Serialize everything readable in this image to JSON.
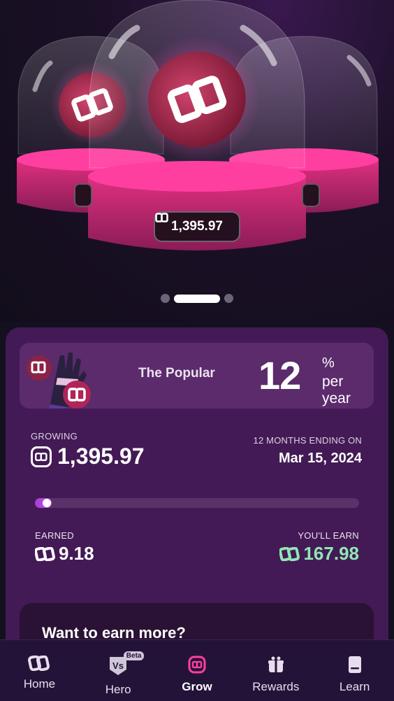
{
  "hero": {
    "amount": "1,395.97",
    "carousel_pages": 3,
    "carousel_active": 2
  },
  "plan": {
    "name": "The Popular",
    "rate": "12",
    "rate_unit": "%",
    "rate_period": "per year"
  },
  "stats": {
    "growing_label": "GROWING",
    "growing_value": "1,395.97",
    "ending_label": "12 MONTHS ENDING ON",
    "ending_date": "Mar 15, 2024",
    "progress": 0.05,
    "earned_label": "EARNED",
    "earned_value": "9.18",
    "will_earn_label": "YOU'LL EARN",
    "will_earn_value": "167.98"
  },
  "promo": {
    "title": "Want to earn more?"
  },
  "nav": {
    "items": [
      {
        "label": "Home",
        "icon": "home-logo-icon"
      },
      {
        "label": "Hero",
        "icon": "vs-shield-icon",
        "badge": "Beta"
      },
      {
        "label": "Grow",
        "icon": "grow-icon",
        "active": true
      },
      {
        "label": "Rewards",
        "icon": "gift-icon"
      },
      {
        "label": "Learn",
        "icon": "book-icon"
      }
    ]
  },
  "colors": {
    "accent_pink": "#e0307f",
    "card_bg": "#431a55",
    "positive_green": "#8fe7b4"
  }
}
